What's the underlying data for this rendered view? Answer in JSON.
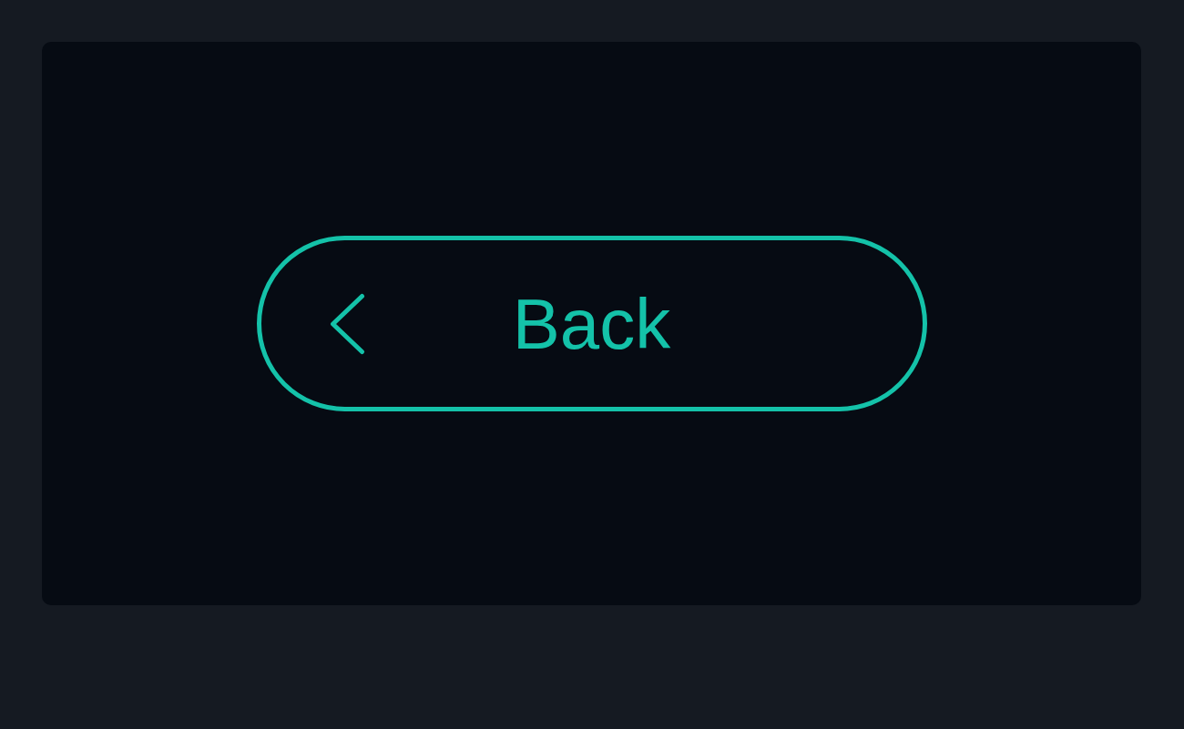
{
  "button": {
    "label": "Back"
  }
}
